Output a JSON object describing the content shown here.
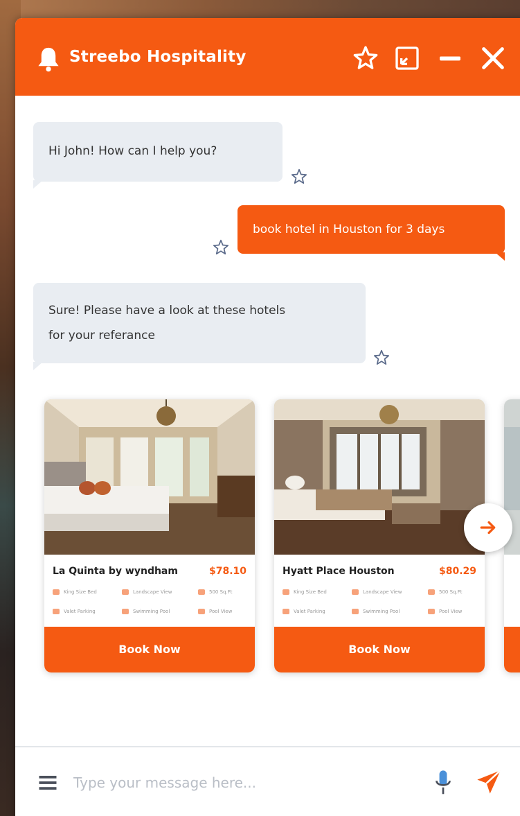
{
  "header": {
    "title": "Streebo Hospitality",
    "icons": [
      "bell-icon",
      "star-icon",
      "expand-icon",
      "minimize-icon",
      "close-icon"
    ]
  },
  "messages": [
    {
      "from": "bot",
      "text": "Hi John! How can I help you?"
    },
    {
      "from": "user",
      "text": "book hotel in Houston for 3 days"
    },
    {
      "from": "bot",
      "line1": "Sure! Please have a look at these hotels",
      "line2": "for your referance"
    }
  ],
  "cards": [
    {
      "name": "La Quinta by wyndham",
      "price": "$78.10",
      "amenities": [
        "King Size Bed",
        "Landscape View",
        "500 Sq.Ft",
        "Valet Parking",
        "Swimming Pool",
        "Pool View"
      ],
      "button": "Book Now"
    },
    {
      "name": "Hyatt Place Houston",
      "price": "$80.29",
      "amenities": [
        "King Size Bed",
        "Landscape View",
        "500 Sq.Ft",
        "Valet Parking",
        "Swimming Pool",
        "Pool View"
      ],
      "button": "Book Now"
    }
  ],
  "footer": {
    "placeholder": "Type your message here..."
  },
  "colors": {
    "accent": "#f55a12",
    "bot_bubble": "#e9edf2"
  }
}
